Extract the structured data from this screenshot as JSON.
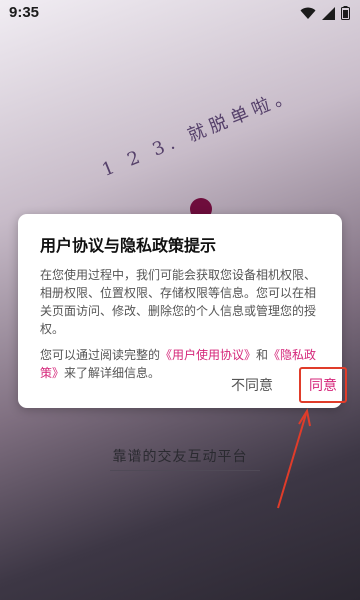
{
  "status_bar": {
    "time": "9:35"
  },
  "background": {
    "slogan": "1 2 3. 就脱单啦。",
    "tagline": "靠谱的交友互动平台"
  },
  "dialog": {
    "title": "用户协议与隐私政策提示",
    "paragraph1": "在您使用过程中，我们可能会获取您设备相机权限、相册权限、位置权限、存储权限等信息。您可以在相关页面访问、修改、删除您的个人信息或管理您的授权。",
    "paragraph2_prefix": "您可以通过阅读完整的",
    "user_agreement_link": "《用户使用协议》",
    "paragraph2_and": "和",
    "privacy_policy_link": "《隐私政策》",
    "paragraph2_suffix": "来了解详细信息。",
    "disagree_label": "不同意",
    "agree_label": "同意"
  },
  "colors": {
    "accent": "#d5267a",
    "annotation": "#e03c2a"
  }
}
